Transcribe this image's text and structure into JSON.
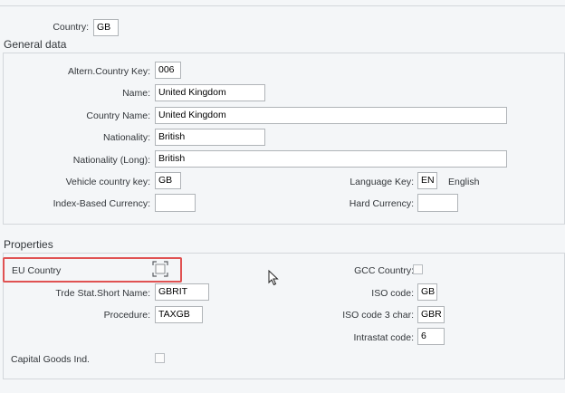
{
  "header": {
    "country_label": "Country:",
    "country_value": "GB"
  },
  "general_data": {
    "title": "General data",
    "altern_country_key": {
      "label": "Altern.Country Key:",
      "value": "006"
    },
    "name": {
      "label": "Name:",
      "value": "United Kingdom"
    },
    "country_name": {
      "label": "Country Name:",
      "value": "United Kingdom"
    },
    "nationality": {
      "label": "Nationality:",
      "value": "British"
    },
    "nationality_long": {
      "label": "Nationality (Long):",
      "value": "British"
    },
    "vehicle_country_key": {
      "label": "Vehicle country key:",
      "value": "GB"
    },
    "language_key": {
      "label": "Language Key:",
      "value": "EN",
      "description": "English"
    },
    "index_based_currency": {
      "label": "Index-Based Currency:",
      "value": ""
    },
    "hard_currency": {
      "label": "Hard Currency:",
      "value": ""
    }
  },
  "properties": {
    "title": "Properties",
    "eu_country": {
      "label": "EU Country",
      "checked": false,
      "highlight_color": "#e05252"
    },
    "gcc_country": {
      "label": "GCC Country:",
      "checked": false
    },
    "trde_stat_short_name": {
      "label": "Trde Stat.Short Name:",
      "value": "GBRIT"
    },
    "iso_code": {
      "label": "ISO code:",
      "value": "GB"
    },
    "procedure": {
      "label": "Procedure:",
      "value": "TAXGB"
    },
    "iso_code_3": {
      "label": "ISO code 3 char:",
      "value": "GBR"
    },
    "intrastat_code": {
      "label": "Intrastat code:",
      "value": "6"
    },
    "capital_goods_ind": {
      "label": "Capital Goods Ind.",
      "checked": false
    }
  }
}
